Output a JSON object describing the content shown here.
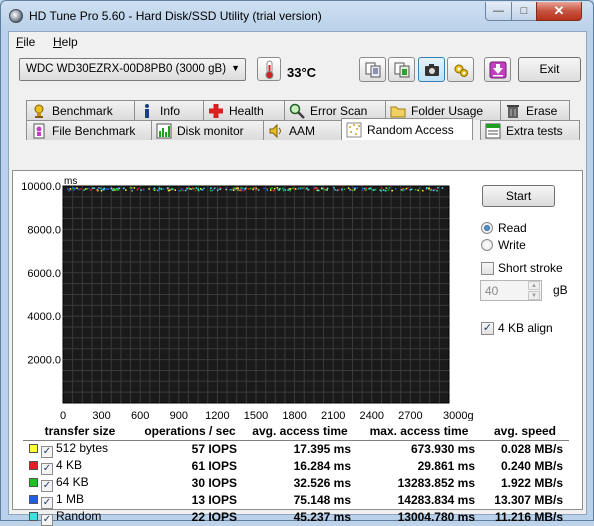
{
  "window": {
    "title": "HD Tune Pro 5.60 - Hard Disk/SSD Utility (trial version)"
  },
  "menu": [
    {
      "label": "File",
      "accel": "F",
      "rest": "ile"
    },
    {
      "label": "Help",
      "accel": "H",
      "rest": "elp"
    }
  ],
  "toolbar": {
    "drive": "WDC WD30EZRX-00D8PB0 (3000 gB)",
    "temperature": "33°C",
    "exit_label": "Exit",
    "buttons": [
      "copy-info-icon",
      "copy-to-clipboard-icon",
      "camera-icon",
      "options-icon",
      "save-download-icon"
    ]
  },
  "tabs": {
    "row1": [
      {
        "label": "Benchmark",
        "icon": "benchmark-icon"
      },
      {
        "label": "Info",
        "icon": "info-icon"
      },
      {
        "label": "Health",
        "icon": "health-icon"
      },
      {
        "label": "Error Scan",
        "icon": "error-scan-icon"
      },
      {
        "label": "Folder Usage",
        "icon": "folder-icon"
      },
      {
        "label": "Erase",
        "icon": "trash-icon"
      }
    ],
    "row2": [
      {
        "label": "File Benchmark",
        "icon": "file-benchmark-icon"
      },
      {
        "label": "Disk monitor",
        "icon": "disk-monitor-icon"
      },
      {
        "label": "AAM",
        "icon": "speaker-icon"
      },
      {
        "label": "Random Access",
        "icon": "random-access-icon",
        "selected": true
      },
      {
        "label": "Extra tests",
        "icon": "extra-tests-icon"
      }
    ]
  },
  "controls": {
    "start_label": "Start",
    "read_label": "Read",
    "write_label": "Write",
    "mode": "read",
    "short_stroke_label": "Short stroke",
    "short_stroke_checked": false,
    "stroke_value": "40",
    "stroke_unit": "gB",
    "align_label": "4 KB align",
    "align_checked": true
  },
  "chart_data": {
    "type": "scatter",
    "ylabel": "ms",
    "xlabel": "gB",
    "x_ticks": [
      "0",
      "300",
      "600",
      "900",
      "1200",
      "1500",
      "1800",
      "2100",
      "2400",
      "2700",
      "3000gB"
    ],
    "y_ticks": [
      "10000.0",
      "8000.0",
      "6000.0",
      "4000.0",
      "2000.0"
    ],
    "xlim": [
      0,
      3000
    ],
    "ylim": [
      0,
      10000
    ],
    "grid": true,
    "background": "#1a1a1a",
    "series": [
      {
        "name": "512 bytes",
        "color": "#ffff40"
      },
      {
        "name": "4 KB",
        "color": "#e02020"
      },
      {
        "name": "64 KB",
        "color": "#20c020"
      },
      {
        "name": "1 MB",
        "color": "#2060e0"
      },
      {
        "name": "Random",
        "color": "#40e0e0"
      }
    ]
  },
  "results": {
    "headers": [
      "transfer size",
      "operations / sec",
      "avg. access time",
      "max. access time",
      "avg. speed"
    ],
    "rows": [
      {
        "size": "512 bytes",
        "color": "#ffff40",
        "ops": "57 IOPS",
        "avg": "17.395 ms",
        "max": "673.930 ms",
        "speed": "0.028 MB/s"
      },
      {
        "size": "4 KB",
        "color": "#e02020",
        "ops": "61 IOPS",
        "avg": "16.284 ms",
        "max": "29.861 ms",
        "speed": "0.240 MB/s"
      },
      {
        "size": "64 KB",
        "color": "#20c020",
        "ops": "30 IOPS",
        "avg": "32.526 ms",
        "max": "13283.852 ms",
        "speed": "1.922 MB/s"
      },
      {
        "size": "1 MB",
        "color": "#2060e0",
        "ops": "13 IOPS",
        "avg": "75.148 ms",
        "max": "14283.834 ms",
        "speed": "13.307 MB/s"
      },
      {
        "size": "Random",
        "color": "#40e0e0",
        "ops": "22 IOPS",
        "avg": "45.237 ms",
        "max": "13004.780 ms",
        "speed": "11.216 MB/s"
      }
    ]
  }
}
